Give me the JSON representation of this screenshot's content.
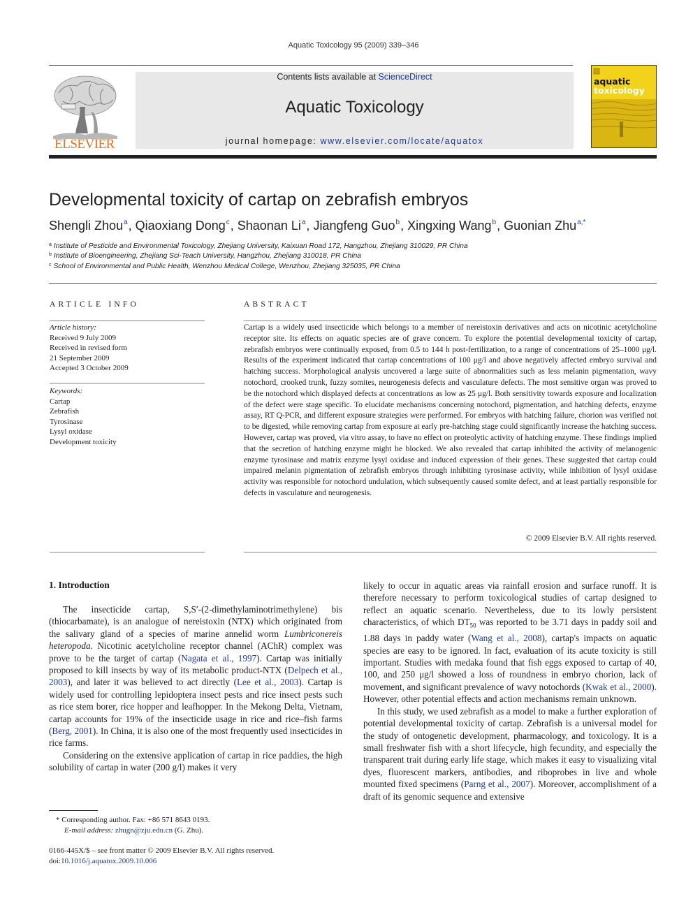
{
  "header": {
    "journal_reference": "Aquatic Toxicology 95 (2009) 339–346",
    "contents_prefix": "Contents lists available at ",
    "contents_link": "ScienceDirect",
    "journal_name": "Aquatic Toxicology",
    "homepage_prefix": "journal homepage: ",
    "homepage_url": "www.elsevier.com/locate/aquatox",
    "publisher_logo_text": "ELSEVIER",
    "cover_title_line1": "aquatic",
    "cover_title_line2": "toxicology"
  },
  "article": {
    "title": "Developmental toxicity of cartap on zebrafish embryos",
    "authors": [
      {
        "name": "Shengli Zhou",
        "affil": "a"
      },
      {
        "name": "Qiaoxiang Dong",
        "affil": "c"
      },
      {
        "name": "Shaonan Li",
        "affil": "a"
      },
      {
        "name": "Jiangfeng Guo",
        "affil": "b"
      },
      {
        "name": "Xingxing Wang",
        "affil": "b"
      },
      {
        "name": "Guonian Zhu",
        "affil": "a,*"
      }
    ],
    "affiliations": [
      {
        "key": "a",
        "text": "Institute of Pesticide and Environmental Toxicology, Zhejiang University, Kaixuan Road 172, Hangzhou, Zhejiang 310029, PR China"
      },
      {
        "key": "b",
        "text": "Institute of Bioengineering, Zhejiang Sci-Teach University, Hangzhou, Zhejiang 310018, PR China"
      },
      {
        "key": "c",
        "text": "School of Environmental and Public Health, Wenzhou Medical College, Wenzhou, Zhejiang 325035, PR China"
      }
    ]
  },
  "article_info": {
    "heading": "ARTICLE INFO",
    "history_label": "Article history:",
    "history": [
      "Received 9 July 2009",
      "Received in revised form",
      "21 September 2009",
      "Accepted 3 October 2009"
    ],
    "keywords_label": "Keywords:",
    "keywords": [
      "Cartap",
      "Zebrafish",
      "Tyrosinase",
      "Lysyl oxidase",
      "Development toxicity"
    ]
  },
  "abstract": {
    "heading": "ABSTRACT",
    "text": "Cartap is a widely used insecticide which belongs to a member of nereistoxin derivatives and acts on nicotinic acetylcholine receptor site. Its effects on aquatic species are of grave concern. To explore the potential developmental toxicity of cartap, zebrafish embryos were continually exposed, from 0.5 to 144 h post-fertilization, to a range of concentrations of 25–1000 μg/l. Results of the experiment indicated that cartap concentrations of 100 μg/l and above negatively affected embryo survival and hatching success. Morphological analysis uncovered a large suite of abnormalities such as less melanin pigmentation, wavy notochord, crooked trunk, fuzzy somites, neurogenesis defects and vasculature defects. The most sensitive organ was proved to be the notochord which displayed defects at concentrations as low as 25 μg/l. Both sensitivity towards exposure and localization of the defect were stage specific. To elucidate mechanisms concerning notochord, pigmentation, and hatching defects, enzyme assay, RT Q-PCR, and different exposure strategies were performed. For embryos with hatching failure, chorion was verified not to be digested, while removing cartap from exposure at early pre-hatching stage could significantly increase the hatching success. However, cartap was proved, via vitro assay, to have no effect on proteolytic activity of hatching enzyme. These findings implied that the secretion of hatching enzyme might be blocked. We also revealed that cartap inhibited the activity of melanogenic enzyme tyrosinase and matrix enzyme lysyl oxidase and induced expression of their genes. These suggested that cartap could impaired melanin pigmentation of zebrafish embryos through inhibiting tyrosinase activity, while inhibition of lysyl oxidase activity was responsible for notochord undulation, which subsequently caused somite defect, and at least partially responsible for defects in vasculature and neurogenesis.",
    "copyright": "© 2009 Elsevier B.V. All rights reserved."
  },
  "body": {
    "section_heading": "1.  Introduction",
    "left_p1": [
      {
        "t": "The insecticide cartap, S,S′-(2-dimethylaminotrimethylene) bis (thiocarbamate), is an analogue of nereistoxin (NTX) which originated from the salivary gland of a species of marine annelid worm "
      },
      {
        "t": "Lumbriconereis heteropoda",
        "style": "italic"
      },
      {
        "t": ". Nicotinic acetylcholine receptor channel (AChR) complex was prove to be the target of cartap ("
      },
      {
        "t": "Nagata et al., 1997",
        "style": "link"
      },
      {
        "t": "). Cartap was initially proposed to kill insects by way of its metabolic product-NTX ("
      },
      {
        "t": "Delpech et al., 2003",
        "style": "link"
      },
      {
        "t": "), and later it was believed to act directly ("
      },
      {
        "t": "Lee et al., 2003",
        "style": "link"
      },
      {
        "t": "). Cartap is widely used for controlling lepidoptera insect pests and rice insect pests such as rice stem borer, rice hopper and leafhopper. In the Mekong Delta, Vietnam, cartap accounts for 19% of the insecticide usage in rice and rice–fish farms ("
      },
      {
        "t": "Berg, 2001",
        "style": "link"
      },
      {
        "t": "). In China, it is also one of the most frequently used insecticides in rice farms."
      }
    ],
    "left_p2": [
      {
        "t": "Considering on the extensive application of cartap in rice paddies, the high solubility of cartap in water (200 g/l) makes it very"
      }
    ],
    "right_p1": [
      {
        "t": "likely to occur in aquatic areas via rainfall erosion and surface runoff. It is therefore necessary to perform toxicological studies of cartap designed to reflect an aquatic scenario. Nevertheless, due to its lowly persistent characteristics, of which DT"
      },
      {
        "t": "50",
        "style": "sub"
      },
      {
        "t": " was reported to be 3.71 days in paddy soil and 1.88 days in paddy water ("
      },
      {
        "t": "Wang et al., 2008",
        "style": "link"
      },
      {
        "t": "), cartap's impacts on aquatic species are easy to be ignored. In fact, evaluation of its acute toxicity is still important. Studies with medaka found that fish eggs exposed to cartap of 40, 100, and 250 μg/l showed a loss of roundness in embryo chorion, lack of movement, and significant prevalence of wavy notochords ("
      },
      {
        "t": "Kwak et al., 2000",
        "style": "link"
      },
      {
        "t": "). However, other potential effects and action mechanisms remain unknown."
      }
    ],
    "right_p2": [
      {
        "t": "In this study, we used zebrafish as a model to make a further exploration of potential developmental toxicity of cartap. Zebrafish is a universal model for the study of ontogenetic development, pharmacology, and toxicology. It is a small freshwater fish with a short lifecycle, high fecundity, and especially the transparent trait during early life stage, which makes it easy to visualizing vital dyes, fluorescent markers, antibodies, and riboprobes in live and whole mounted fixed specimens ("
      },
      {
        "t": "Parng et al., 2007",
        "style": "link"
      },
      {
        "t": "). Moreover, accomplishment of a draft of its genomic sequence and extensive"
      }
    ]
  },
  "footnotes": {
    "corresponding": "*   Corresponding author. Fax: +86 571 8643 0193.",
    "email_label": "E-mail address: ",
    "email": "zhugn@zju.edu.cn",
    "email_suffix": " (G. Zhu).",
    "issn": "0166-445X/$ – see front matter © 2009 Elsevier B.V. All rights reserved.",
    "doi_prefix": "doi:",
    "doi": "10.1016/j.aquatox.2009.10.006"
  },
  "colors": {
    "link": "#1f3a93",
    "elsevier_orange": "#e9711c",
    "cover_yellow": "#f2d21b",
    "header_band": "#e8e8e8"
  }
}
